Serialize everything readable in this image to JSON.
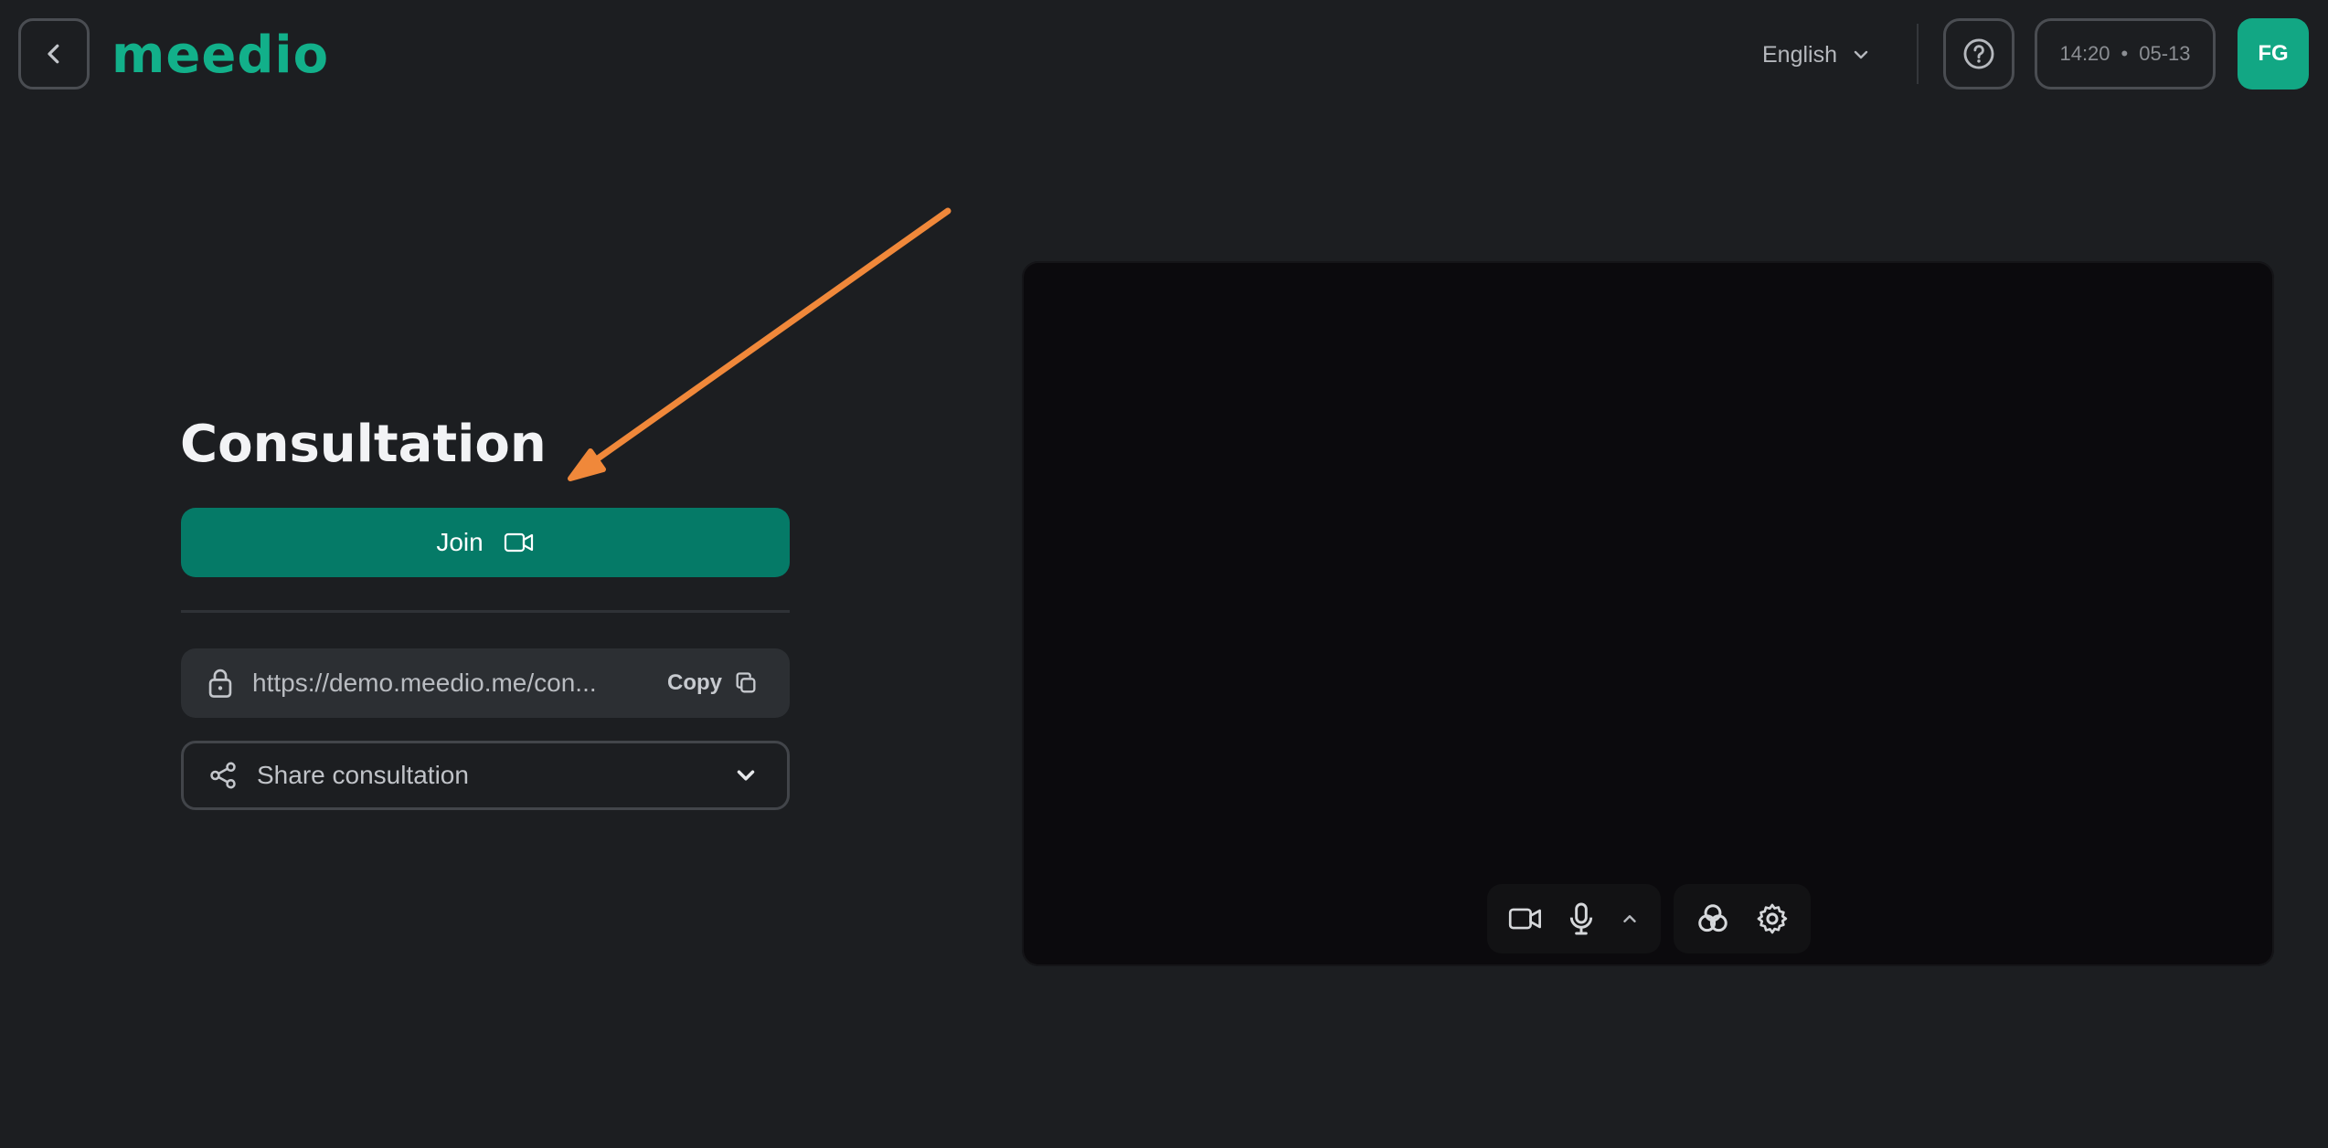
{
  "header": {
    "logo_text": "meedio",
    "language": "English",
    "time": "14:20",
    "separator": "•",
    "date": "05-13",
    "avatar_initials": "FG"
  },
  "main": {
    "title": "Consultation",
    "join_label": "Join",
    "link_text": "https://demo.meedio.me/con...",
    "copy_label": "Copy",
    "share_label": "Share consultation"
  },
  "colors": {
    "background": "#1c1e21",
    "brand": "#12b08a",
    "join_button": "#057a67",
    "annotation_arrow": "#f0883a"
  },
  "icons": {
    "back": "chevron-left-icon",
    "language_dropdown": "chevron-down-icon",
    "help": "question-circle-icon",
    "join": "video-camera-icon",
    "link": "lock-icon",
    "copy": "copy-icon",
    "share": "share-icon",
    "share_dropdown": "chevron-down-icon",
    "camera_toggle": "video-camera-icon",
    "mic_toggle": "microphone-icon",
    "mic_options": "chevron-up-icon",
    "effects": "effects-icon",
    "settings": "gear-icon"
  }
}
